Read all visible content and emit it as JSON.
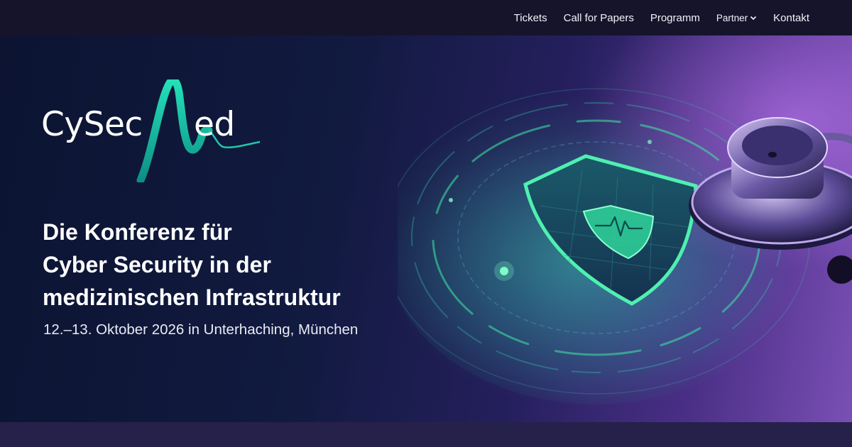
{
  "nav": {
    "items": [
      {
        "label": "Tickets"
      },
      {
        "label": "Call for Papers"
      },
      {
        "label": "Programm"
      },
      {
        "label": "Partner",
        "has_dropdown": true
      },
      {
        "label": "Kontakt"
      }
    ]
  },
  "logo": {
    "text_left": "CySec",
    "text_right": "ed",
    "mark_icon": "heartbeat-m-icon",
    "colors": {
      "mark_start": "#1fd6b0",
      "mark_end": "#0e8f8a"
    }
  },
  "hero": {
    "headline": [
      "Die Konferenz für",
      "Cyber Security in der",
      "medizinischen Infrastruktur"
    ],
    "subline": "12.–13. Oktober 2026 in Unterhaching, München",
    "illustration": "shield-stethoscope-icon"
  },
  "colors": {
    "nav_bg": "#15142b",
    "hero_dark": "#0c1432",
    "hero_purple": "#7a4fb5",
    "accent_green": "#3fe6a4"
  }
}
